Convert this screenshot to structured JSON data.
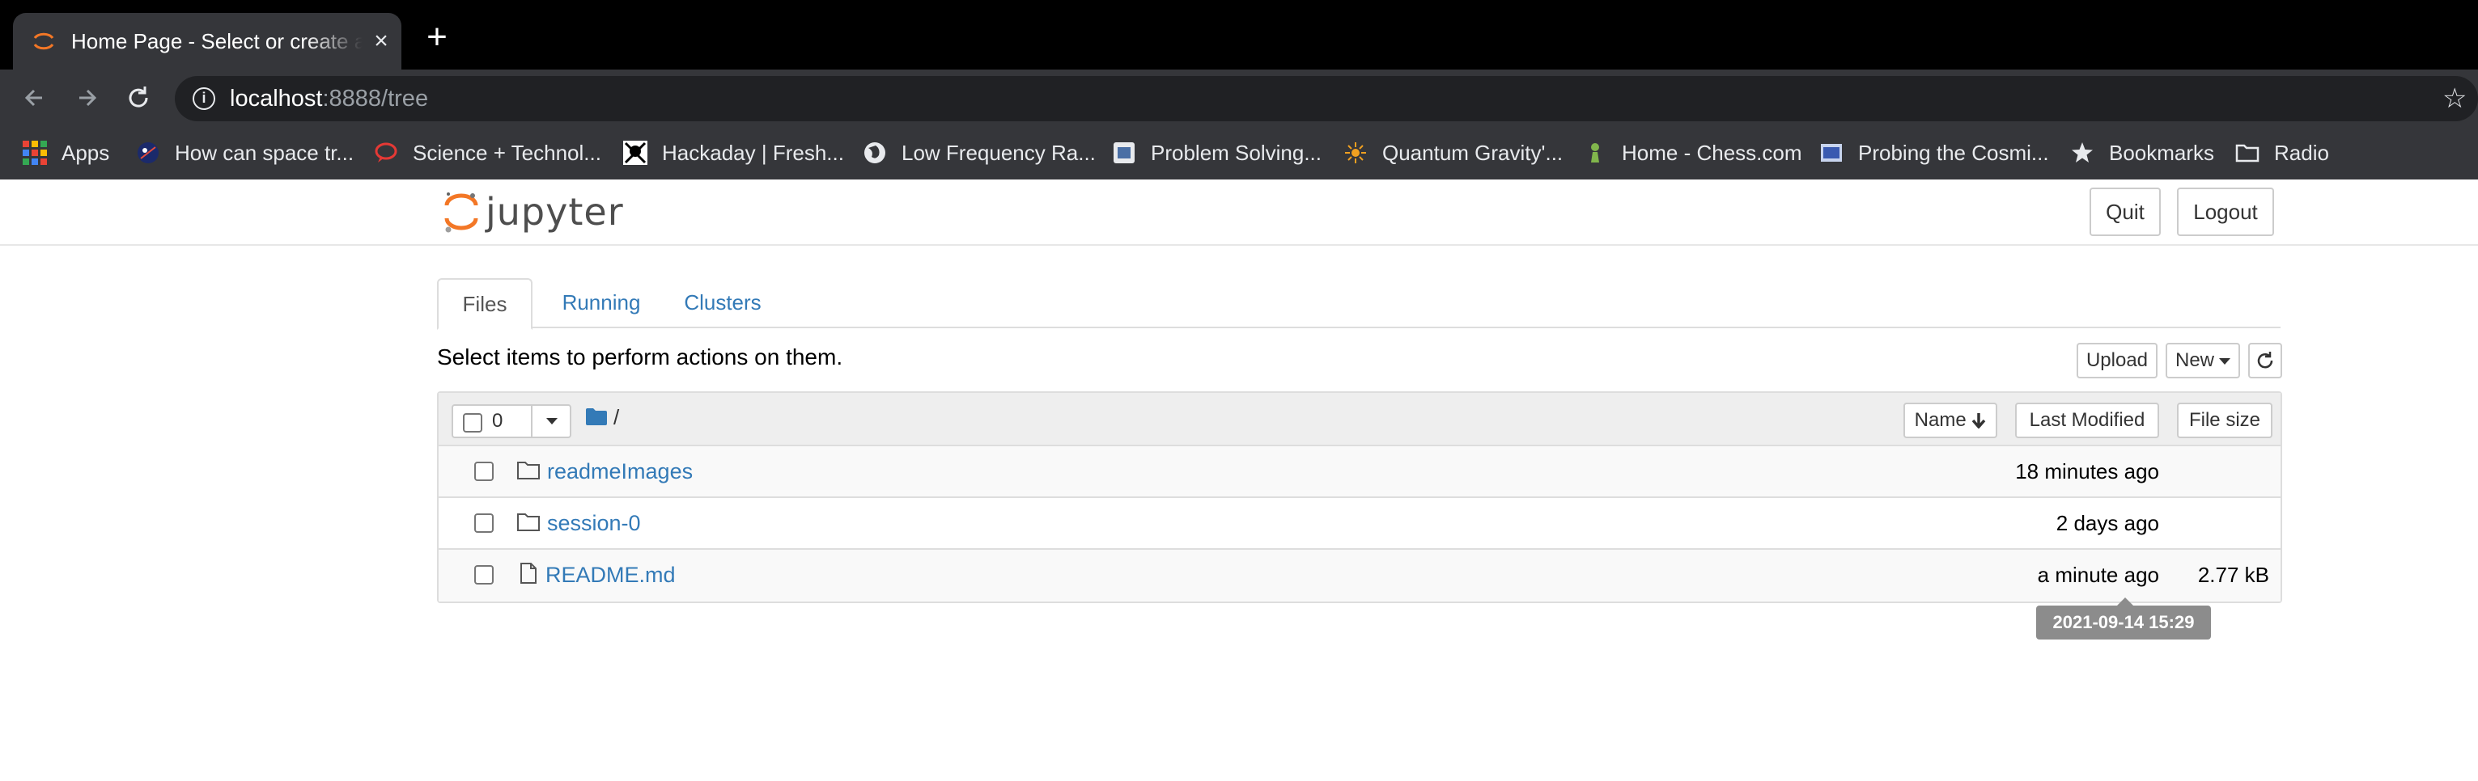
{
  "browser": {
    "tab_title": "Home Page - Select or create a notebook",
    "url_host": "localhost",
    "url_rest": ":8888/tree",
    "bookmarks": [
      {
        "label": "Apps",
        "icon": "apps-grid-icon"
      },
      {
        "label": "How can space tr...",
        "icon": "space-icon"
      },
      {
        "label": "Science + Technol...",
        "icon": "speech-bubble-icon"
      },
      {
        "label": "Hackaday | Fresh...",
        "icon": "skull-crossbones-icon"
      },
      {
        "label": "Low Frequency Ra...",
        "icon": "globe-icon"
      },
      {
        "label": "Problem Solving...",
        "icon": "doc-icon"
      },
      {
        "label": "Quantum Gravity'...",
        "icon": "sun-icon"
      },
      {
        "label": "Home - Chess.com",
        "icon": "chess-pawn-icon"
      },
      {
        "label": "Probing the Cosmi...",
        "icon": "image-icon"
      },
      {
        "label": "Bookmarks",
        "icon": "star-icon"
      },
      {
        "label": "Radio",
        "icon": "folder-icon"
      }
    ]
  },
  "header": {
    "logo_text": "jupyter",
    "quit_label": "Quit",
    "logout_label": "Logout"
  },
  "tabs": [
    {
      "label": "Files",
      "active": true
    },
    {
      "label": "Running",
      "active": false
    },
    {
      "label": "Clusters",
      "active": false
    }
  ],
  "toolbar": {
    "instructions": "Select items to perform actions on them.",
    "upload_label": "Upload",
    "new_label": "New",
    "refresh_icon": "refresh-icon"
  },
  "list_header": {
    "selected_count": "0",
    "path": "/",
    "sort_name_label": "Name",
    "sort_name_icon": "arrow-down-icon",
    "sort_modified_label": "Last Modified",
    "sort_size_label": "File size"
  },
  "items": [
    {
      "name": "readmeImages",
      "type": "folder",
      "modified": "18 minutes ago",
      "size": ""
    },
    {
      "name": "session-0",
      "type": "folder",
      "modified": "2 days ago",
      "size": ""
    },
    {
      "name": "README.md",
      "type": "file",
      "modified": "a minute ago",
      "size": "2.77 kB"
    }
  ],
  "tooltip": "2021-09-14 15:29",
  "colors": {
    "link": "#337ab7",
    "jupyter_orange": "#f37726",
    "chrome_dark": "#35363a"
  }
}
